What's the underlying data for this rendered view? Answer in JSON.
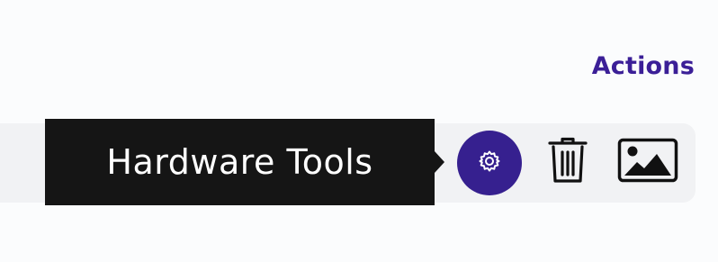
{
  "header": {
    "title": "Actions"
  },
  "tooltip": {
    "text": "Hardware Tools"
  },
  "actions": [
    {
      "icon": "gear-icon",
      "label": "Hardware Tools"
    },
    {
      "icon": "trash-icon",
      "label": ""
    },
    {
      "icon": "image-icon",
      "label": ""
    }
  ],
  "colors": {
    "accent": "#36208f",
    "heading": "#3b1f97",
    "tooltip_bg": "#151515",
    "row_bg": "#f1f2f4"
  }
}
